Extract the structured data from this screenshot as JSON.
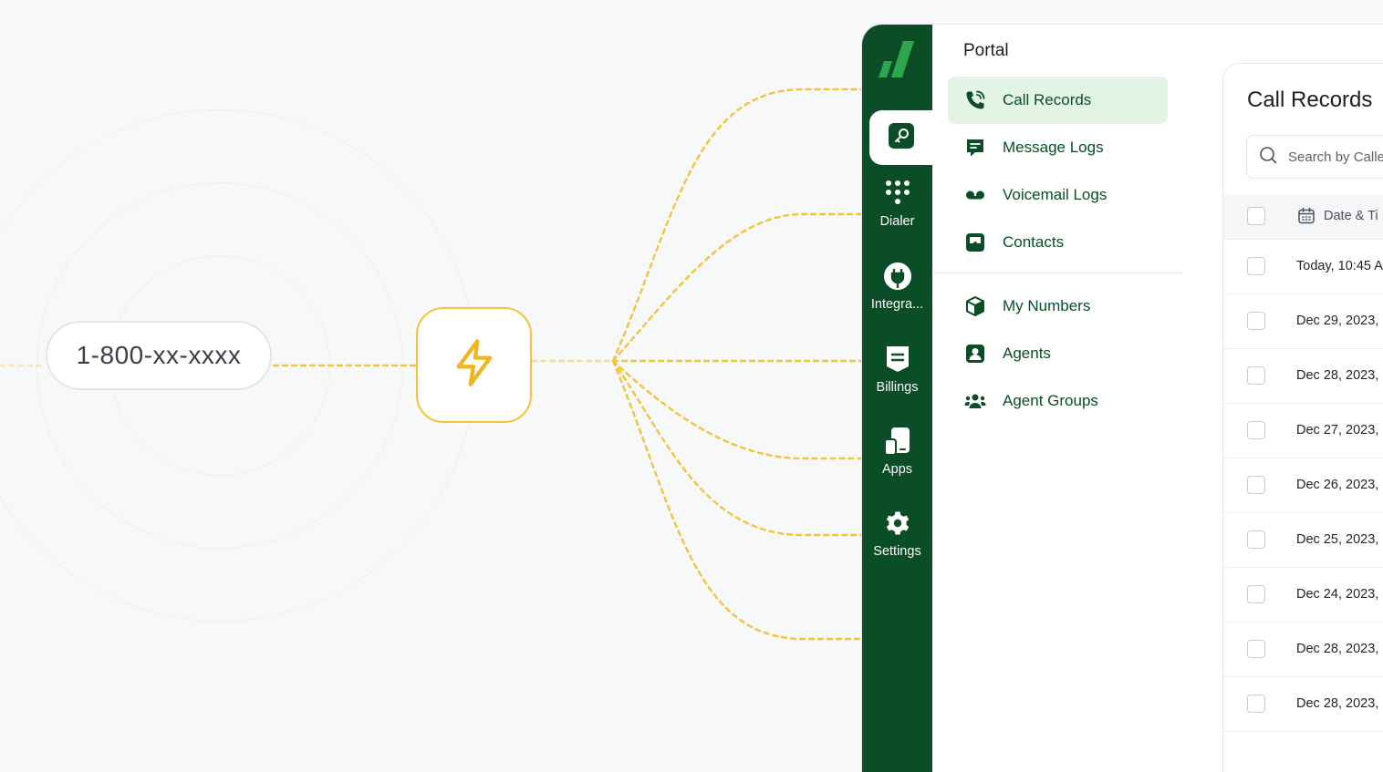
{
  "colors": {
    "brand_green": "#0b4d27",
    "active_bg": "#e3f4e7",
    "accent_yellow": "#f3c43b"
  },
  "flow": {
    "phone_number": "1-800-xx-xxxx",
    "trigger_icon": "lightning-bolt-icon"
  },
  "sidebar": {
    "logo_icon": "brand-logo-icon",
    "active_item_icon": "key-icon",
    "items": [
      {
        "label": "Dialer",
        "icon": "dialpad-icon"
      },
      {
        "label": "Integra...",
        "icon": "plug-icon"
      },
      {
        "label": "Billings",
        "icon": "receipt-icon"
      },
      {
        "label": "Apps",
        "icon": "apps-icon"
      },
      {
        "label": "Settings",
        "icon": "gear-icon"
      }
    ]
  },
  "panel": {
    "title": "Portal",
    "items": [
      {
        "label": "Call Records",
        "icon": "phone-call-icon",
        "active": true
      },
      {
        "label": "Message Logs",
        "icon": "message-icon"
      },
      {
        "label": "Voicemail Logs",
        "icon": "voicemail-icon"
      },
      {
        "label": "Contacts",
        "icon": "contacts-icon"
      },
      {
        "label": "My Numbers",
        "icon": "cube-icon"
      },
      {
        "label": "Agents",
        "icon": "agent-icon"
      },
      {
        "label": "Agent Groups",
        "icon": "agent-groups-icon"
      }
    ]
  },
  "call_records": {
    "title": "Call Records",
    "search_placeholder": "Search by Calle",
    "column_date": "Date & Ti",
    "rows": [
      "Today, 10:45 A",
      "Dec 29, 2023,",
      "Dec 28, 2023,",
      "Dec 27, 2023,",
      "Dec 26, 2023,",
      "Dec 25, 2023,",
      "Dec 24, 2023,",
      "Dec 28, 2023,",
      "Dec 28, 2023,"
    ]
  }
}
